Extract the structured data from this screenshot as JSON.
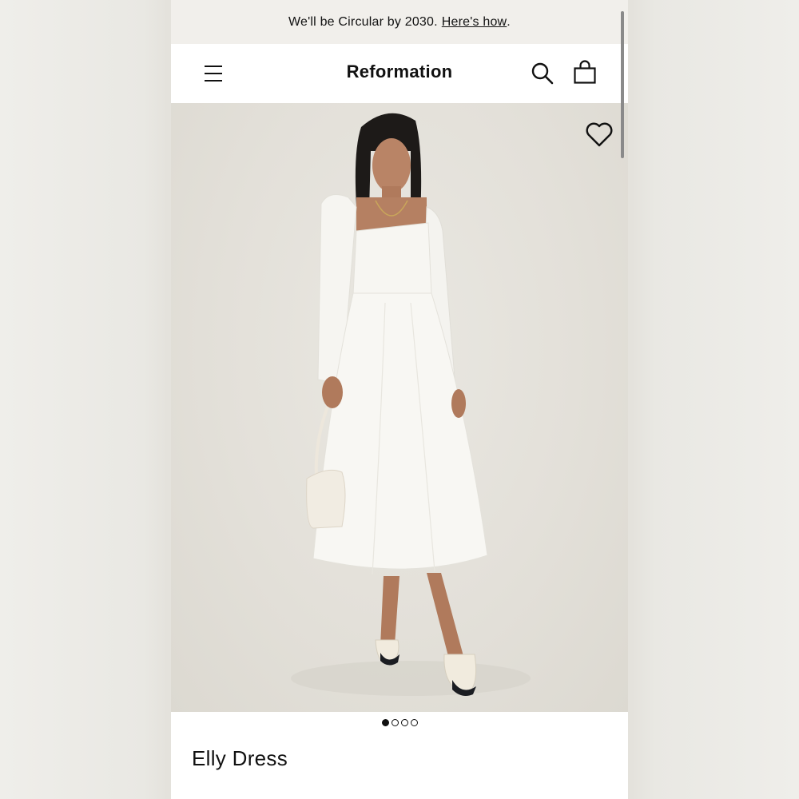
{
  "promo": {
    "text": "We'll be Circular by 2030.",
    "link_label": "Here's how",
    "suffix": "."
  },
  "header": {
    "brand": "Reformation",
    "icons": [
      "menu-icon",
      "search-icon",
      "bag-icon"
    ]
  },
  "hero": {
    "favorite_icon": "heart-icon",
    "carousel": {
      "total": 4,
      "active_index": 0
    }
  },
  "product": {
    "name": "Elly Dress"
  },
  "colors": {
    "promo_bg": "#f1efeb",
    "hero_bg": "#e3e0d9",
    "text": "#111111"
  }
}
